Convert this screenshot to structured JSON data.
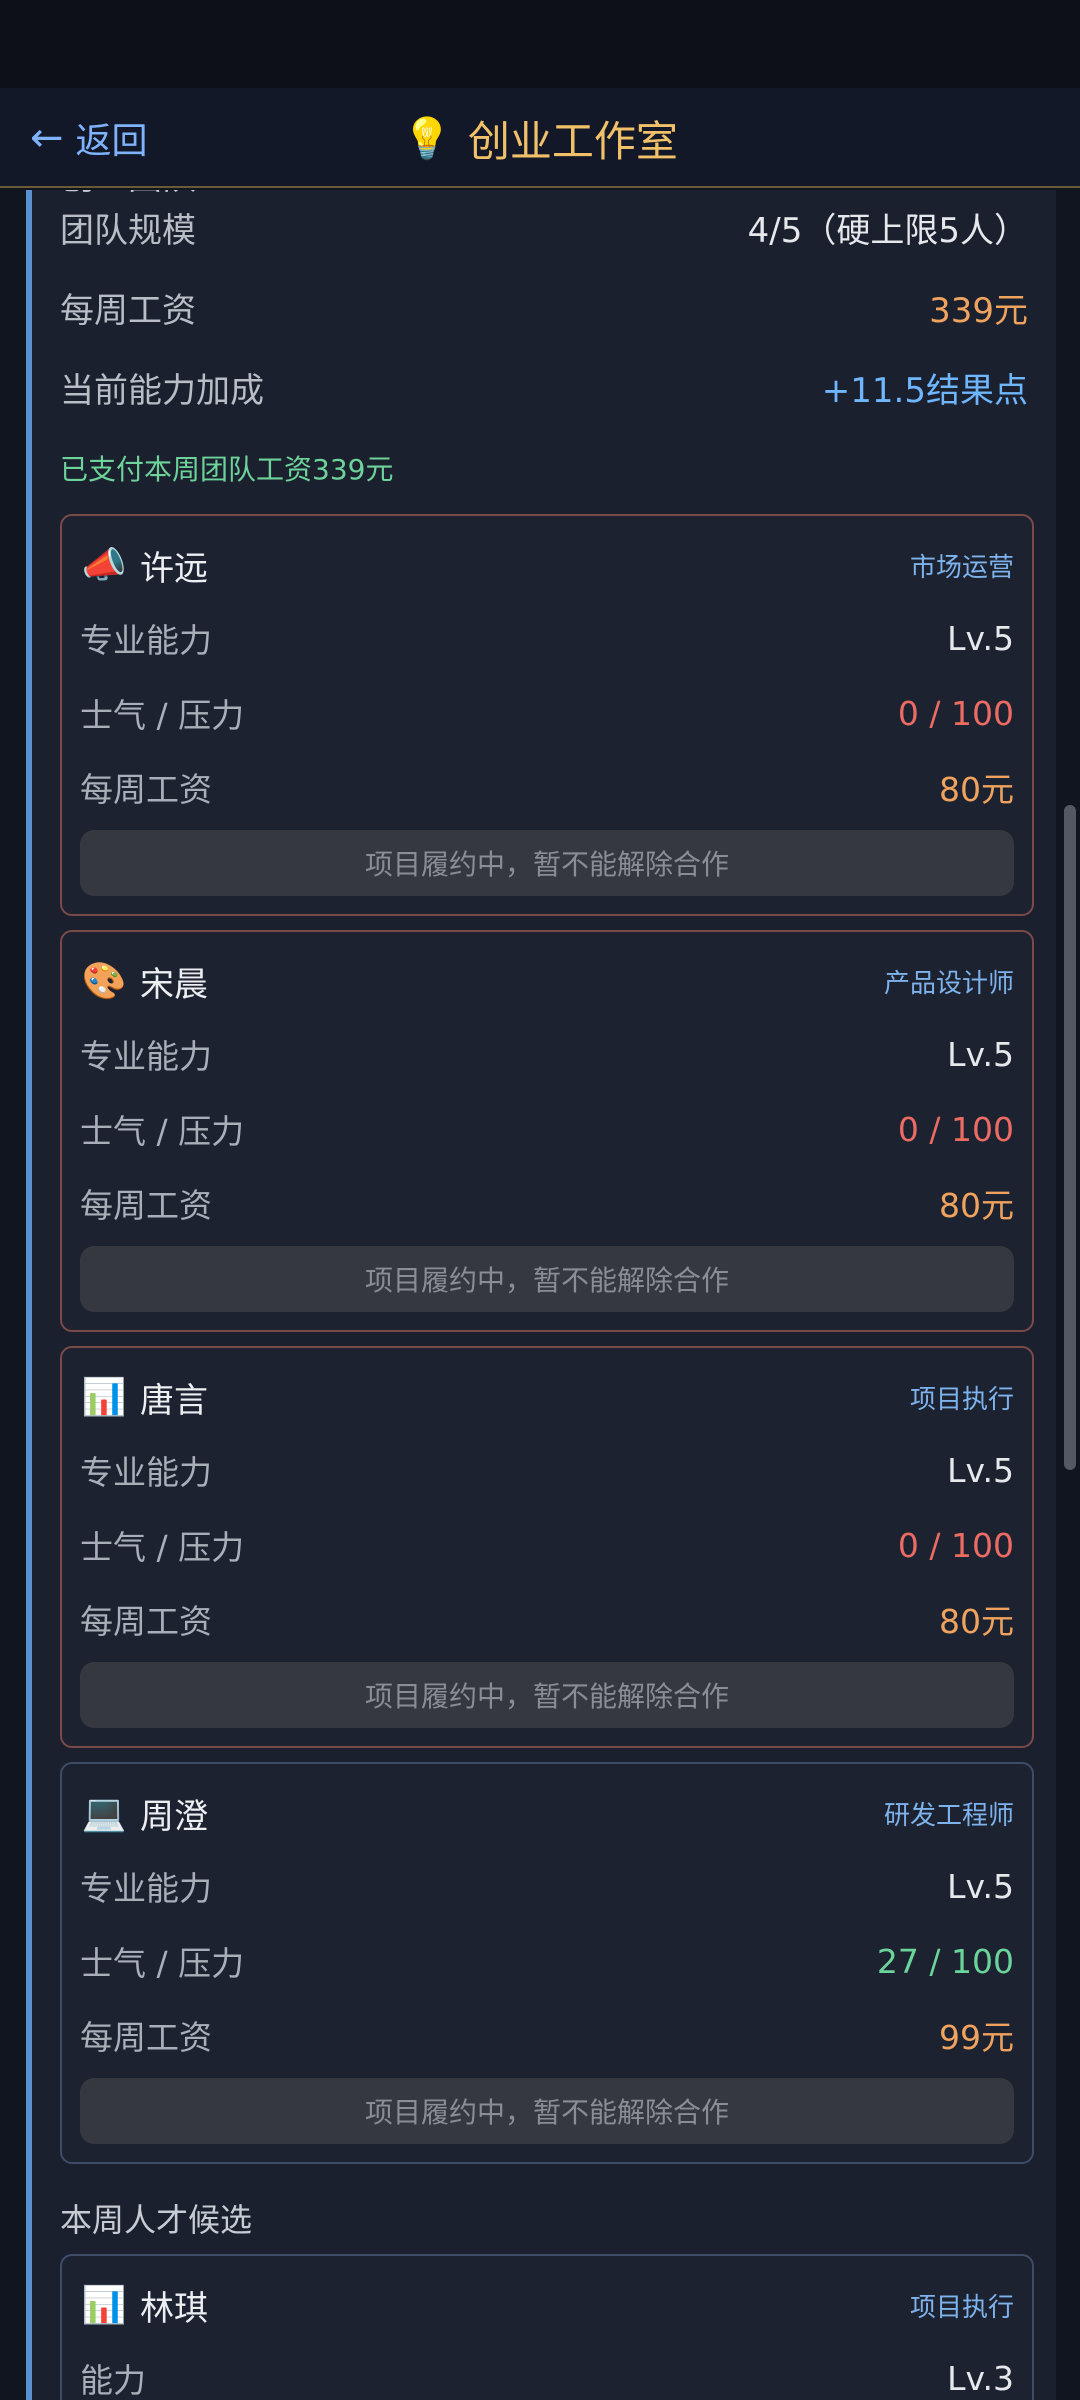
{
  "nav": {
    "back_label": "返回",
    "title": "创业工作室",
    "title_icon": "lightbulb-icon"
  },
  "team": {
    "section_title_partial": "创业团队",
    "size_label": "团队规模",
    "size_value": "4/5（硬上限5人）",
    "wage_label": "每周工资",
    "wage_value": "339元",
    "bonus_label": "当前能力加成",
    "bonus_value": "+11.5结果点",
    "paid_note": "已支付本周团队工资339元"
  },
  "members": [
    {
      "icon": "megaphone-icon",
      "emoji": "📣",
      "name": "许远",
      "role": "市场运营",
      "skill_label": "专业能力",
      "skill_value": "Lv.5",
      "morale_label": "士气 / 压力",
      "morale_value": "0 / 100",
      "morale_color": "#ec6b63",
      "wage_label": "每周工资",
      "wage_value": "80元",
      "action_label": "项目履约中，暂不能解除合作"
    },
    {
      "icon": "palette-icon",
      "emoji": "🎨",
      "name": "宋晨",
      "role": "产品设计师",
      "skill_label": "专业能力",
      "skill_value": "Lv.5",
      "morale_label": "士气 / 压力",
      "morale_value": "0 / 100",
      "morale_color": "#ec6b63",
      "wage_label": "每周工资",
      "wage_value": "80元",
      "action_label": "项目履约中，暂不能解除合作"
    },
    {
      "icon": "bar-chart-icon",
      "emoji": "📊",
      "name": "唐言",
      "role": "项目执行",
      "skill_label": "专业能力",
      "skill_value": "Lv.5",
      "morale_label": "士气 / 压力",
      "morale_value": "0 / 100",
      "morale_color": "#ec6b63",
      "wage_label": "每周工资",
      "wage_value": "80元",
      "action_label": "项目履约中，暂不能解除合作"
    },
    {
      "icon": "laptop-icon",
      "emoji": "💻",
      "name": "周澄",
      "role": "研发工程师",
      "skill_label": "专业能力",
      "skill_value": "Lv.5",
      "morale_label": "士气 / 压力",
      "morale_value": "27 / 100",
      "morale_color": "#6bd49a",
      "wage_label": "每周工资",
      "wage_value": "99元",
      "action_label": "项目履约中，暂不能解除合作"
    }
  ],
  "candidates": {
    "title": "本周人才候选",
    "items": [
      {
        "icon": "bar-chart-icon",
        "emoji": "📊",
        "name": "林琪",
        "role": "项目执行",
        "skill_label": "能力",
        "skill_value": "Lv.3"
      }
    ]
  },
  "colors": {
    "accent_gold": "#f1c16a",
    "link_blue": "#7fb3ff",
    "wage_orange": "#f0a35e",
    "bonus_blue": "#6fb6ff",
    "paid_green": "#6dd39a"
  }
}
